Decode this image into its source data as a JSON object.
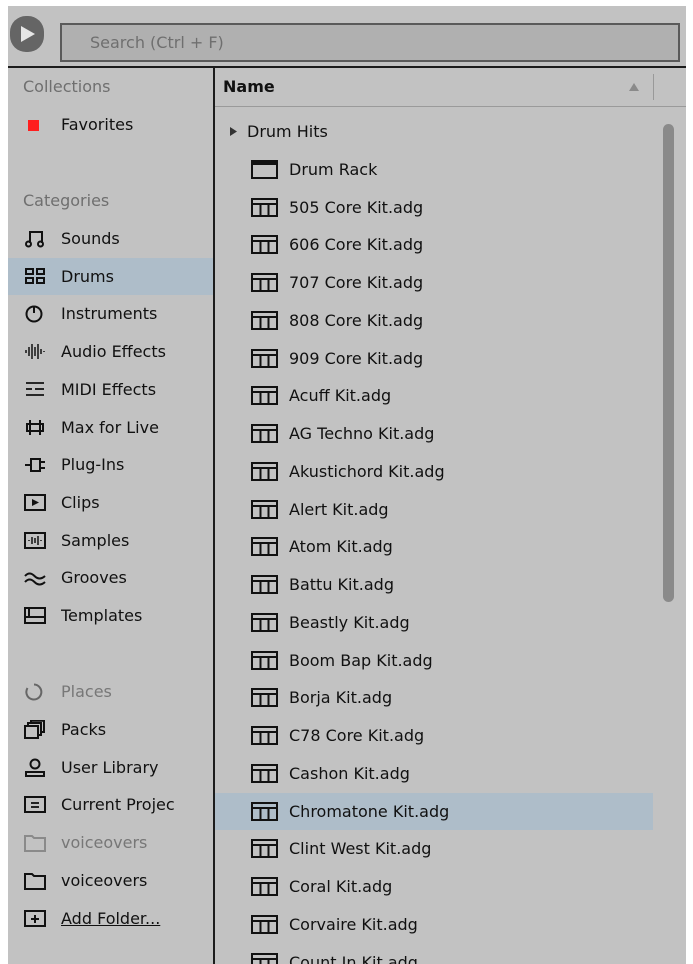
{
  "search": {
    "placeholder": "Search (Ctrl + F)"
  },
  "sidebar": {
    "collections_label": "Collections",
    "favorites_label": "Favorites",
    "favorites_color": "#ff1e1e",
    "categories_label": "Categories",
    "categories": [
      {
        "label": "Sounds",
        "icon": "sounds-icon"
      },
      {
        "label": "Drums",
        "icon": "drums-icon",
        "selected": true
      },
      {
        "label": "Instruments",
        "icon": "instruments-icon"
      },
      {
        "label": "Audio Effects",
        "icon": "audio-effects-icon"
      },
      {
        "label": "MIDI Effects",
        "icon": "midi-effects-icon"
      },
      {
        "label": "Max for Live",
        "icon": "max-for-live-icon"
      },
      {
        "label": "Plug-Ins",
        "icon": "plug-ins-icon"
      },
      {
        "label": "Clips",
        "icon": "clips-icon"
      },
      {
        "label": "Samples",
        "icon": "samples-icon"
      },
      {
        "label": "Grooves",
        "icon": "grooves-icon"
      },
      {
        "label": "Templates",
        "icon": "templates-icon"
      }
    ],
    "places_label": "Places",
    "places": [
      {
        "label": "Packs",
        "icon": "packs-icon"
      },
      {
        "label": "User Library",
        "icon": "user-library-icon"
      },
      {
        "label": "Current Projec",
        "icon": "current-project-icon"
      },
      {
        "label": "voiceovers",
        "icon": "folder-icon",
        "dimmed": true
      },
      {
        "label": "voiceovers",
        "icon": "folder-icon"
      },
      {
        "label": "Add Folder...",
        "icon": "add-folder-icon"
      }
    ]
  },
  "content": {
    "column_name": "Name",
    "folder_label": "Drum Hits",
    "rack_label": "Drum Rack",
    "selected_index": 18,
    "items": [
      "505 Core Kit.adg",
      "606 Core Kit.adg",
      "707 Core Kit.adg",
      "808 Core Kit.adg",
      "909 Core Kit.adg",
      "Acuff Kit.adg",
      "AG Techno Kit.adg",
      "Akustichord Kit.adg",
      "Alert Kit.adg",
      "Atom Kit.adg",
      "Battu Kit.adg",
      "Beastly Kit.adg",
      "Boom Bap Kit.adg",
      "Borja Kit.adg",
      "C78 Core Kit.adg",
      "Cashon Kit.adg",
      "Chromatone Kit.adg",
      "Clint West Kit.adg",
      "Coral Kit.adg",
      "Corvaire Kit.adg",
      "Count In Kit.adg"
    ]
  },
  "colors": {
    "selection": "#aebdc9",
    "panel": "#c2c2c2"
  }
}
